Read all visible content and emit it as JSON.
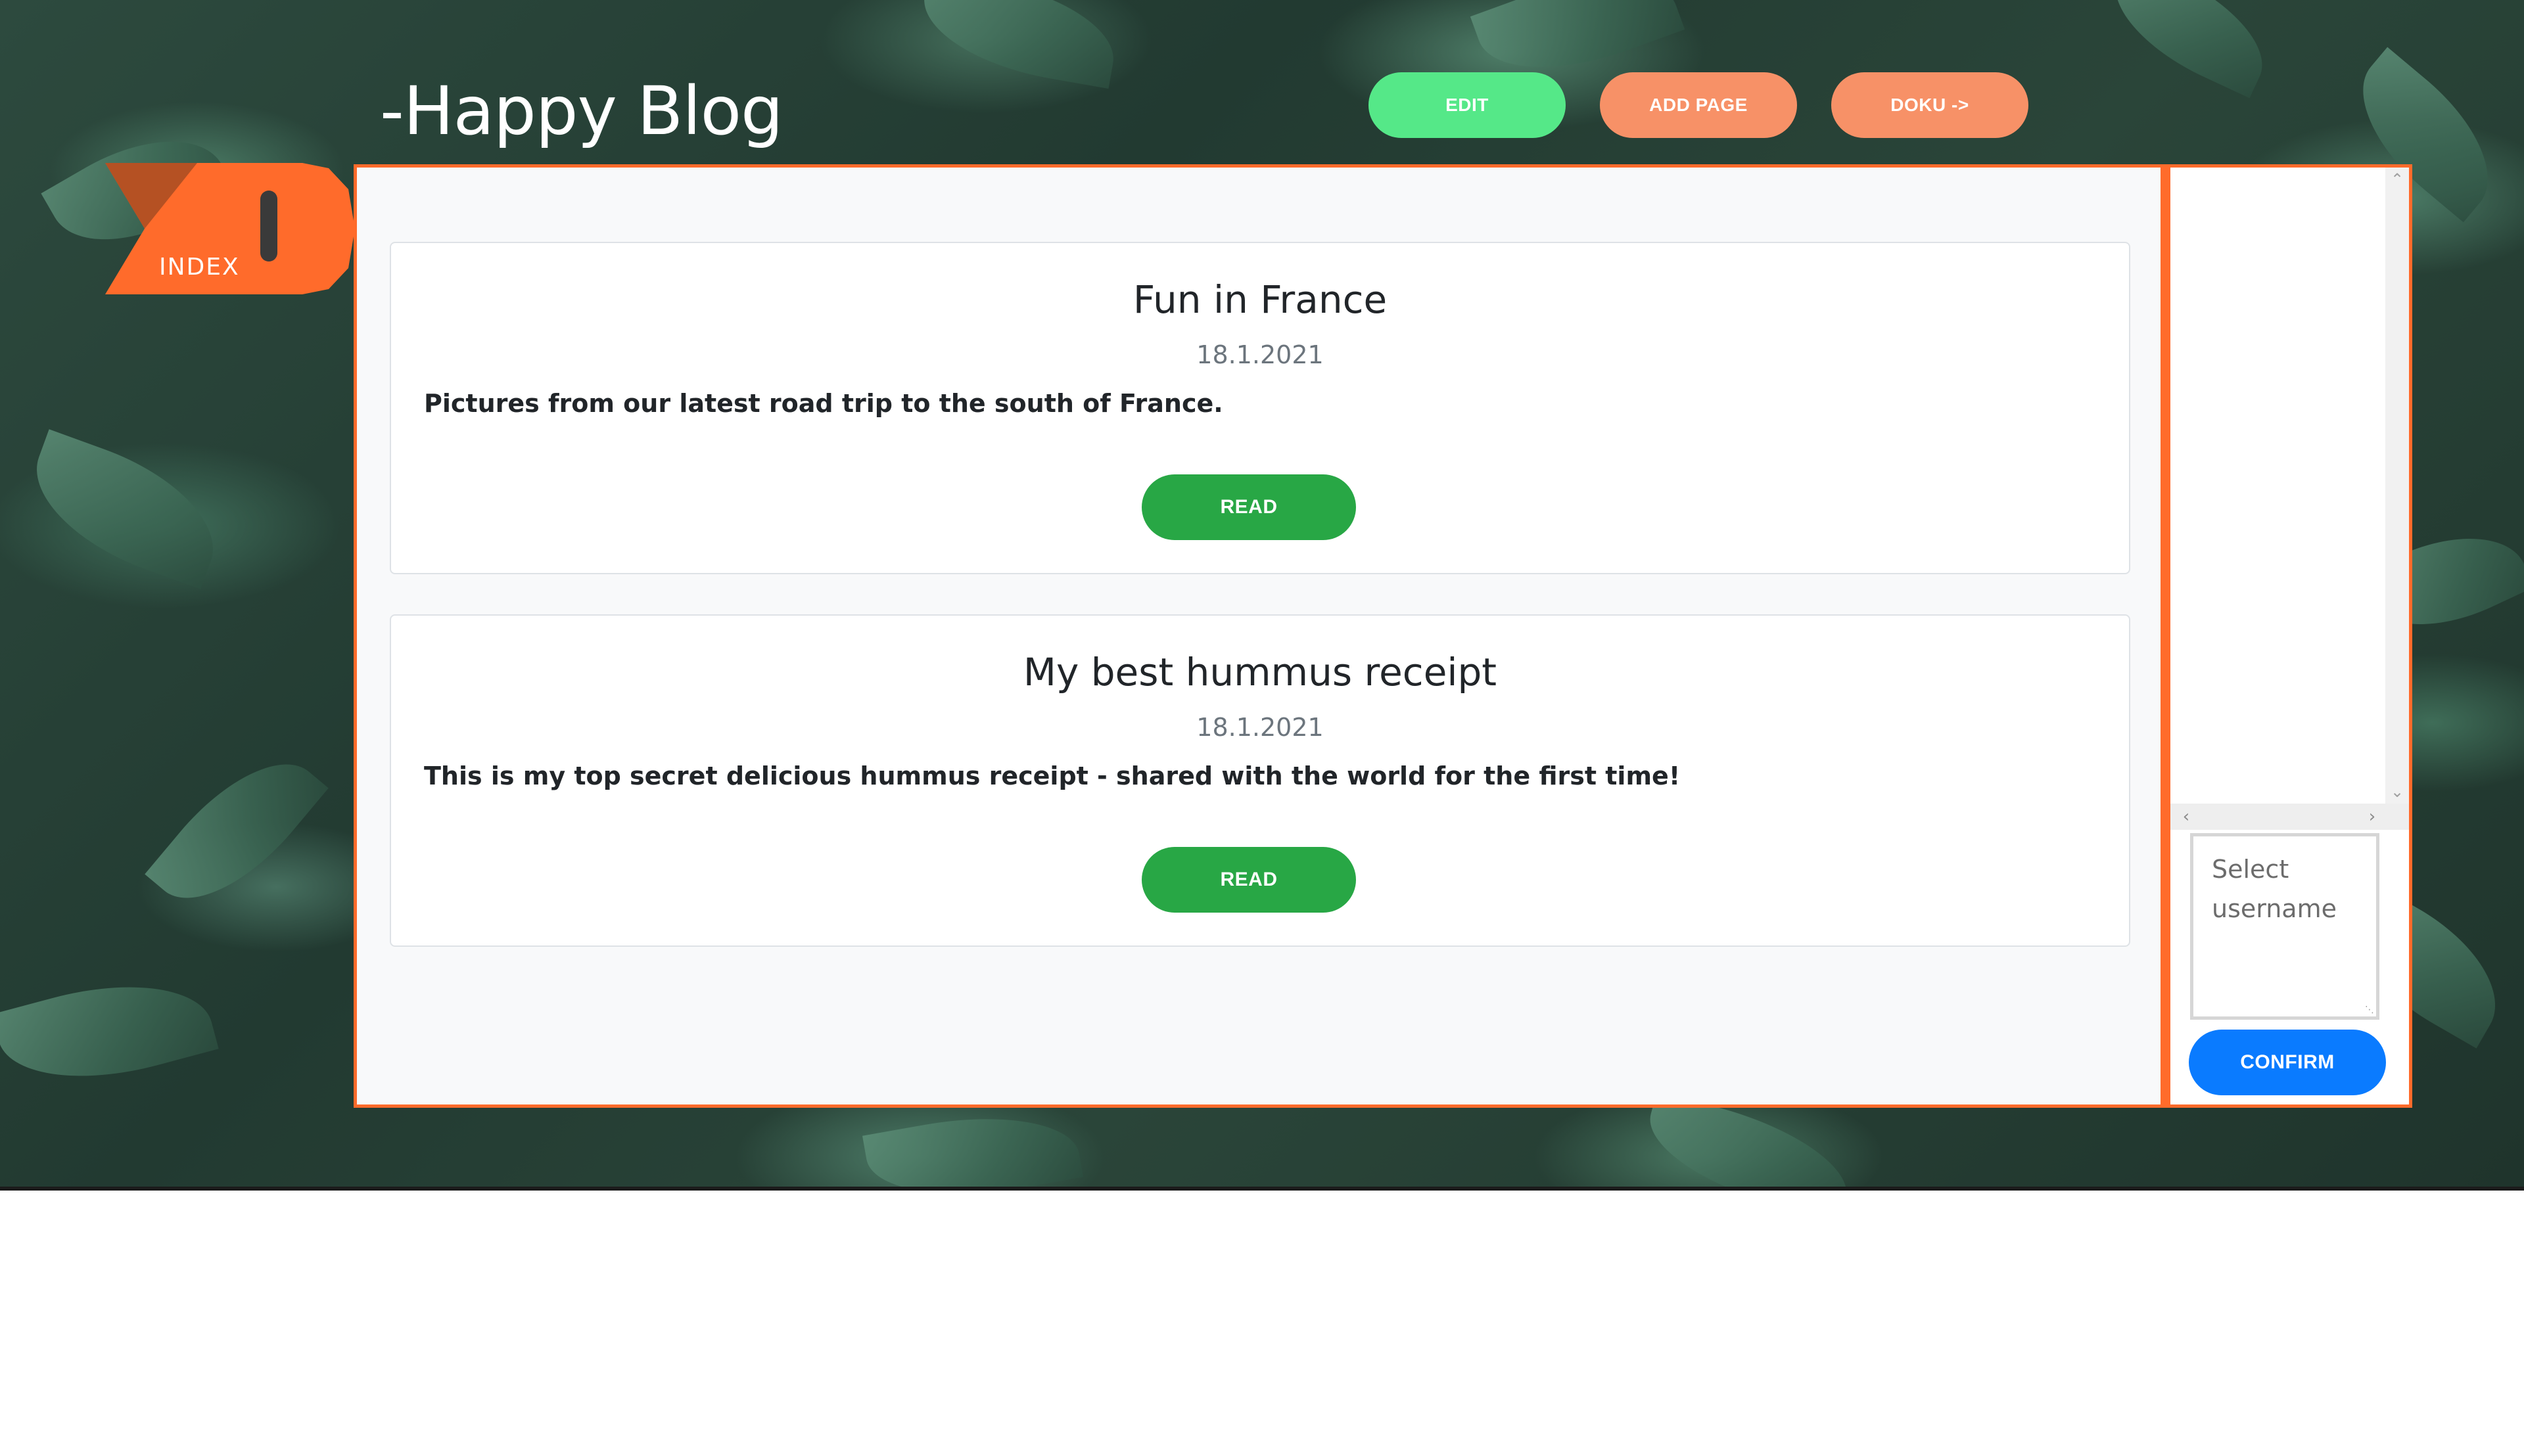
{
  "header": {
    "site_title": "-Happy Blog",
    "buttons": {
      "edit_label": "EDIT",
      "add_page_label": "ADD PAGE",
      "doku_label": "DOKU ->"
    }
  },
  "index_tab": {
    "label": "INDEX"
  },
  "posts": [
    {
      "title": "Fun in France",
      "date": "18.1.2021",
      "summary": "Pictures from our latest road trip to the south of France.",
      "read_label": "READ"
    },
    {
      "title": "My best hummus receipt",
      "date": "18.1.2021",
      "summary": "This is my top secret delicious hummus receipt - shared with the world for the first time!",
      "read_label": "READ"
    }
  ],
  "side_panel": {
    "username_placeholder": "Select username",
    "confirm_label": "CONFIRM"
  },
  "colors": {
    "accent_orange": "#ff6b2b",
    "edit_green": "#55e888",
    "pill_orange": "#f79167",
    "read_green": "#28a745",
    "confirm_blue": "#0a7bff"
  }
}
